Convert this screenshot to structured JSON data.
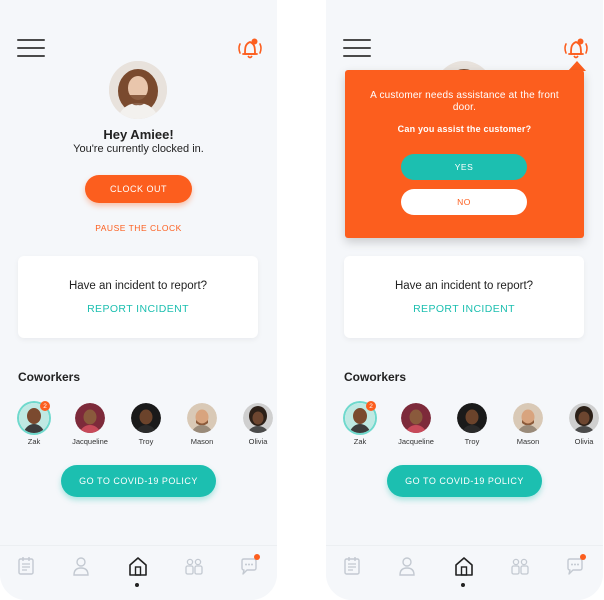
{
  "home": {
    "greeting": "Hey Amiee!",
    "status": "You're currently clocked in.",
    "clock_out_label": "CLOCK OUT",
    "pause_label": "PAUSE THE CLOCK"
  },
  "incident": {
    "question": "Have an incident to report?",
    "link_label": "REPORT INCIDENT"
  },
  "coworkers": {
    "title": "Coworkers",
    "items": [
      {
        "name": "Zak",
        "badge": "2"
      },
      {
        "name": "Jacqueline"
      },
      {
        "name": "Troy"
      },
      {
        "name": "Mason"
      },
      {
        "name": "Olivia"
      }
    ]
  },
  "covid_button_label": "GO TO COVID-19 POLICY",
  "tabs": [
    "calendar-icon",
    "profile-icon",
    "home-icon",
    "team-icon",
    "chat-icon"
  ],
  "popup": {
    "message": "A customer needs assistance at the front door.",
    "question": "Can you assist the customer?",
    "yes_label": "YES",
    "no_label": "NO"
  },
  "colors": {
    "accent_orange": "#fc5e1e",
    "accent_teal": "#1cbfb0",
    "background": "#f5f7fa"
  }
}
